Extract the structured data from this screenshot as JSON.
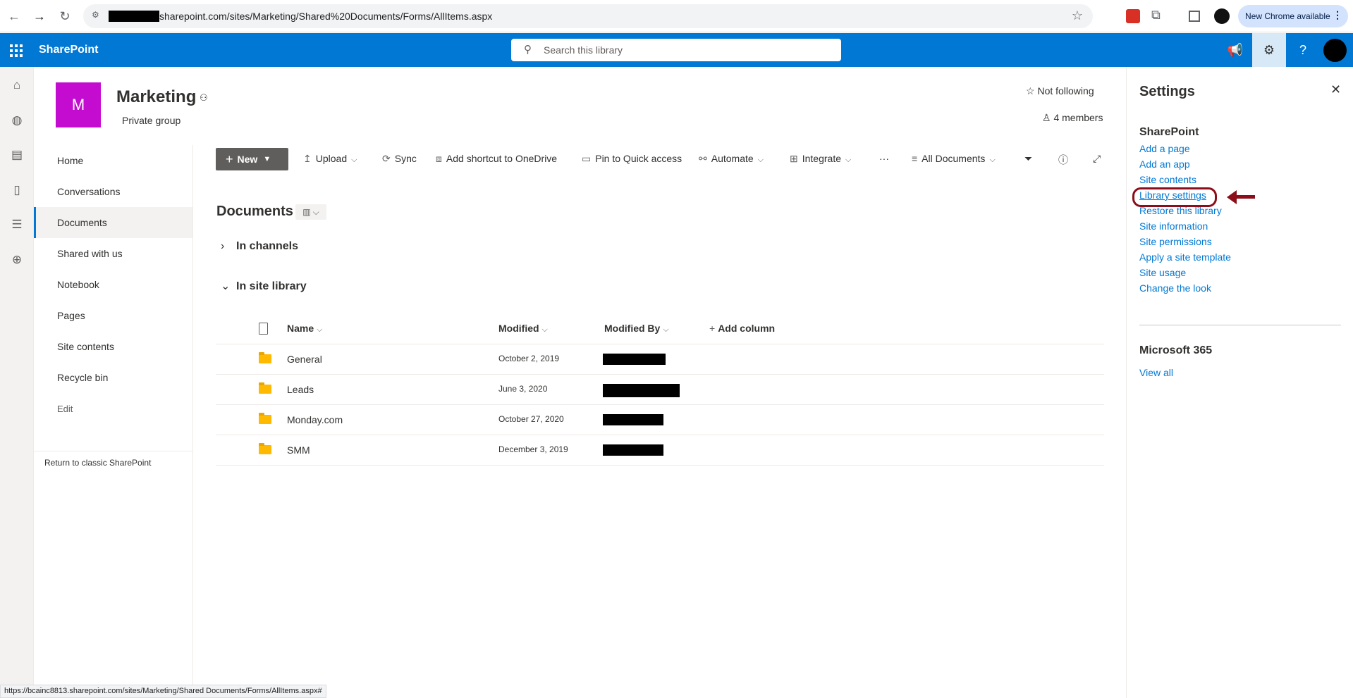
{
  "browser": {
    "url": "sharepoint.com/sites/Marketing/Shared%20Documents/Forms/AllItems.aspx",
    "update_label": "New Chrome available",
    "status_url": "https://bcainc8813.sharepoint.com/sites/Marketing/Shared Documents/Forms/AllItems.aspx#"
  },
  "suite": {
    "brand": "SharePoint",
    "search_placeholder": "Search this library"
  },
  "site": {
    "logo_letter": "M",
    "logo_color": "#c30cd0",
    "title": "Marketing",
    "subtitle": "Private group",
    "follow_label": "Not following",
    "members_label": "4 members"
  },
  "nav": {
    "items": [
      {
        "label": "Home"
      },
      {
        "label": "Conversations"
      },
      {
        "label": "Documents"
      },
      {
        "label": "Shared with us"
      },
      {
        "label": "Notebook"
      },
      {
        "label": "Pages"
      },
      {
        "label": "Site contents"
      },
      {
        "label": "Recycle bin"
      },
      {
        "label": "Edit"
      }
    ],
    "return_classic": "Return to classic SharePoint"
  },
  "commands": {
    "new": "New",
    "upload": "Upload",
    "sync": "Sync",
    "shortcut": "Add shortcut to OneDrive",
    "pin": "Pin to Quick access",
    "automate": "Automate",
    "integrate": "Integrate",
    "more": "···",
    "view": "All Documents"
  },
  "library": {
    "title": "Documents",
    "groups": {
      "channels": "In channels",
      "site_library": "In site library"
    },
    "columns": {
      "name": "Name",
      "modified": "Modified",
      "modified_by": "Modified By",
      "add_column": "Add column"
    },
    "rows": [
      {
        "name": "General",
        "modified": "October 2, 2019"
      },
      {
        "name": "Leads",
        "modified": "June 3, 2020"
      },
      {
        "name": "Monday.com",
        "modified": "October 27, 2020"
      },
      {
        "name": "SMM",
        "modified": "December 3, 2019"
      }
    ]
  },
  "settings": {
    "title": "Settings",
    "sharepoint_title": "SharePoint",
    "links": [
      "Add a page",
      "Add an app",
      "Site contents",
      "Library settings",
      "Restore this library",
      "Site information",
      "Site permissions",
      "Apply a site template",
      "Site usage",
      "Change the look"
    ],
    "m365_title": "Microsoft 365",
    "view_all": "View all"
  },
  "colors": {
    "accent": "#0078d4",
    "annotation": "#8b0e1a"
  }
}
